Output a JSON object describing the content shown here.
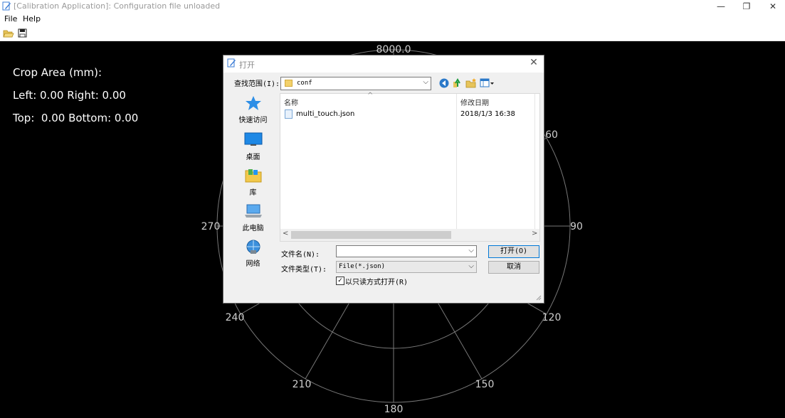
{
  "window": {
    "title": "[Calibration Application]: Configuration file unloaded",
    "minimize": "—",
    "restore": "❐",
    "close": "✕"
  },
  "menu": {
    "file": "File",
    "help": "Help"
  },
  "toolbar": {
    "open_icon": "folder-open-icon",
    "save_icon": "save-icon"
  },
  "crop": {
    "title": "Crop Area (mm):",
    "left_right": "Left: 0.00 Right: 0.00",
    "top_bottom": "Top:  0.00 Bottom: 0.00"
  },
  "polar": {
    "radius_label": "8000.0",
    "angle_labels": {
      "a60": "60",
      "a90": "90",
      "a120": "120",
      "a150": "150",
      "a180": "180",
      "a210": "210",
      "a240": "240",
      "a270": "270"
    }
  },
  "dialog": {
    "title": "打开",
    "close": "✕",
    "look_in_label": "查找范围(I):",
    "look_in_value": "conf",
    "nav_icons": [
      "back-icon",
      "up-folder-icon",
      "new-folder-icon",
      "view-menu-icon"
    ],
    "places": [
      {
        "label": "快速访问",
        "icon": "quick-access-icon"
      },
      {
        "label": "桌面",
        "icon": "desktop-icon"
      },
      {
        "label": "库",
        "icon": "library-icon"
      },
      {
        "label": "此电脑",
        "icon": "this-pc-icon"
      },
      {
        "label": "网络",
        "icon": "network-icon"
      }
    ],
    "columns": {
      "name": "名称",
      "date": "修改日期"
    },
    "files": [
      {
        "name": "multi_touch.json",
        "date": "2018/1/3 16:38"
      }
    ],
    "filename_label": "文件名(N):",
    "filename_value": "",
    "filetype_label": "文件类型(T):",
    "filetype_value": "File(*.json)",
    "open_button": "打开(O)",
    "cancel_button": "取消",
    "readonly_label": "以只读方式打开(R)",
    "readonly_checked": true,
    "check_mark": "☑"
  }
}
